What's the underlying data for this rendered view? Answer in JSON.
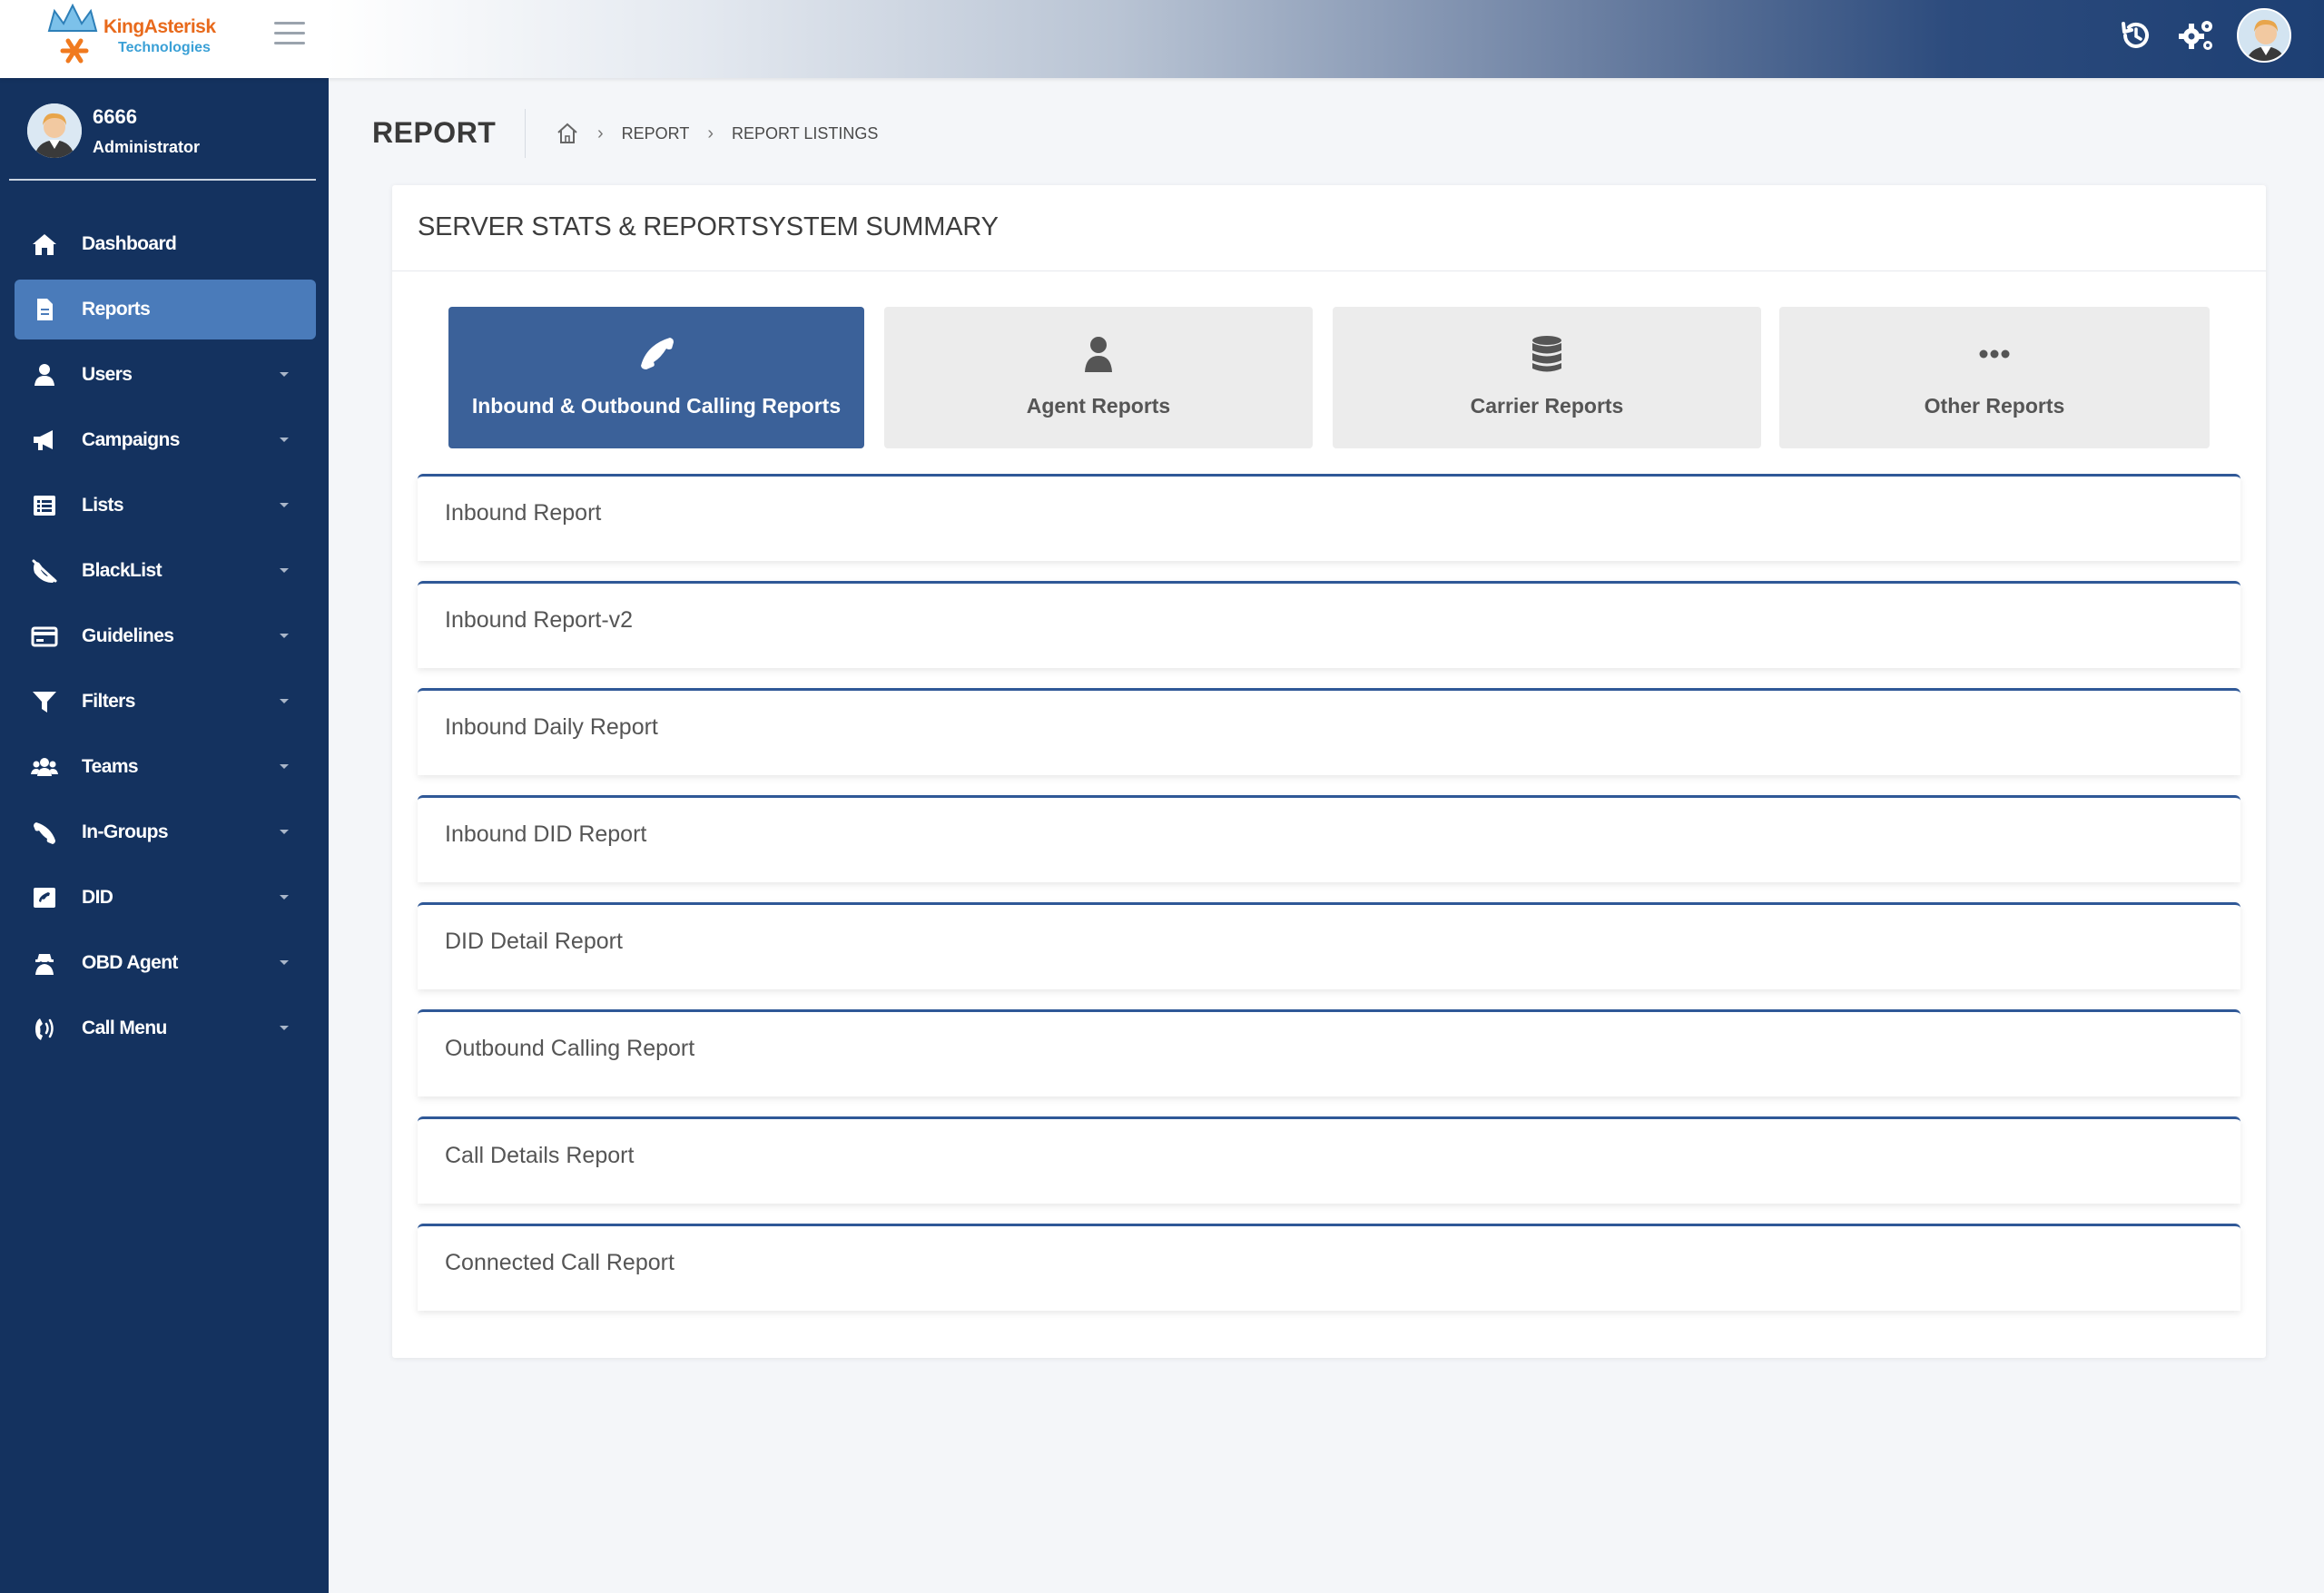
{
  "brand": {
    "name": "KingAsterisk",
    "sub": "Technologies"
  },
  "user": {
    "name": "6666",
    "role": "Administrator"
  },
  "sidebar": {
    "items": [
      {
        "label": "Dashboard",
        "icon": "home-icon",
        "active": false,
        "has_caret": false
      },
      {
        "label": "Reports",
        "icon": "file-icon",
        "active": true,
        "has_caret": false
      },
      {
        "label": "Users",
        "icon": "user-icon",
        "active": false,
        "has_caret": true
      },
      {
        "label": "Campaigns",
        "icon": "megaphone-icon",
        "active": false,
        "has_caret": true
      },
      {
        "label": "Lists",
        "icon": "list-icon",
        "active": false,
        "has_caret": true
      },
      {
        "label": "BlackList",
        "icon": "blocked-phone-icon",
        "active": false,
        "has_caret": true
      },
      {
        "label": "Guidelines",
        "icon": "credit-card-icon",
        "active": false,
        "has_caret": true
      },
      {
        "label": "Filters",
        "icon": "filter-icon",
        "active": false,
        "has_caret": true
      },
      {
        "label": "Teams",
        "icon": "users-icon",
        "active": false,
        "has_caret": true
      },
      {
        "label": "In-Groups",
        "icon": "phone-icon",
        "active": false,
        "has_caret": true
      },
      {
        "label": "DID",
        "icon": "did-icon",
        "active": false,
        "has_caret": true
      },
      {
        "label": "OBD Agent",
        "icon": "agent-icon",
        "active": false,
        "has_caret": true
      },
      {
        "label": "Call Menu",
        "icon": "phone-volume-icon",
        "active": false,
        "has_caret": true
      }
    ]
  },
  "header": {
    "title": "REPORT",
    "breadcrumb": [
      "REPORT",
      "REPORT LISTINGS"
    ]
  },
  "card": {
    "title": "SERVER STATS & REPORTSYSTEM SUMMARY"
  },
  "tabs": [
    {
      "label": "Inbound & Outbound Calling Reports",
      "icon": "phone-icon",
      "active": true
    },
    {
      "label": "Agent Reports",
      "icon": "user-icon",
      "active": false
    },
    {
      "label": "Carrier Reports",
      "icon": "database-icon",
      "active": false
    },
    {
      "label": "Other Reports",
      "icon": "ellipsis-icon",
      "active": false
    }
  ],
  "reports": [
    {
      "label": "Inbound Report"
    },
    {
      "label": "Inbound Report-v2"
    },
    {
      "label": "Inbound Daily Report"
    },
    {
      "label": "Inbound DID Report"
    },
    {
      "label": "DID Detail Report"
    },
    {
      "label": "Outbound Calling Report"
    },
    {
      "label": "Call Details Report"
    },
    {
      "label": "Connected Call Report"
    }
  ],
  "colors": {
    "sidebar_bg": "#14325f",
    "active_nav": "#4a7bba",
    "active_tab": "#3b6199",
    "report_border": "#2f5897"
  }
}
